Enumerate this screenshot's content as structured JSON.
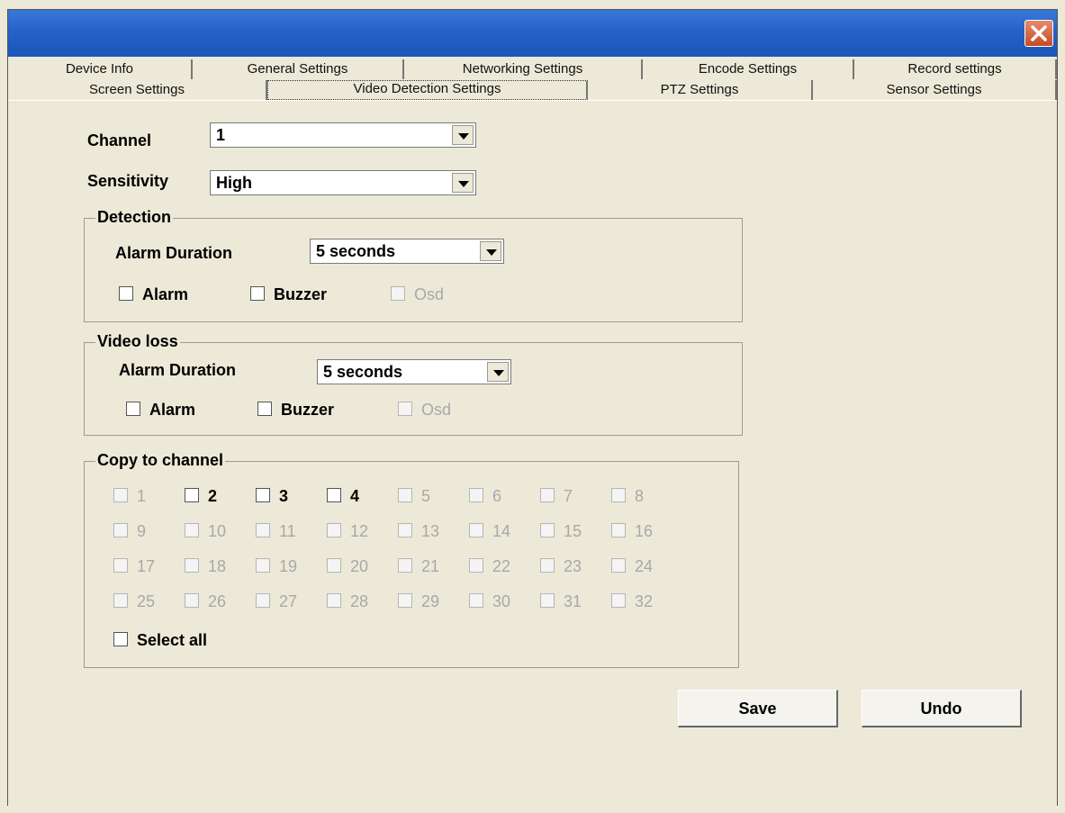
{
  "window": {
    "tabs_row1": [
      "Device Info",
      "General Settings",
      "Networking Settings",
      "Encode Settings",
      "Record settings"
    ],
    "tabs_row2": [
      "Screen Settings",
      "Video Detection Settings",
      "PTZ Settings",
      "Sensor Settings"
    ],
    "active_tab": "Video Detection Settings"
  },
  "form": {
    "channel_label": "Channel",
    "channel_value": "1",
    "sensitivity_label": "Sensitivity",
    "sensitivity_value": "High"
  },
  "detection": {
    "title": "Detection",
    "alarm_duration_label": "Alarm Duration",
    "alarm_duration_value": "5 seconds",
    "alarm": "Alarm",
    "buzzer": "Buzzer",
    "osd": "Osd"
  },
  "video_loss": {
    "title": "Video loss",
    "alarm_duration_label": "Alarm Duration",
    "alarm_duration_value": "5 seconds",
    "alarm": "Alarm",
    "buzzer": "Buzzer",
    "osd": "Osd"
  },
  "copy": {
    "title": "Copy to channel",
    "channels": [
      "1",
      "2",
      "3",
      "4",
      "5",
      "6",
      "7",
      "8",
      "9",
      "10",
      "11",
      "12",
      "13",
      "14",
      "15",
      "16",
      "17",
      "18",
      "19",
      "20",
      "21",
      "22",
      "23",
      "24",
      "25",
      "26",
      "27",
      "28",
      "29",
      "30",
      "31",
      "32"
    ],
    "enabled_channels": [
      "2",
      "3",
      "4"
    ],
    "select_all": "Select all"
  },
  "buttons": {
    "save": "Save",
    "undo": "Undo"
  },
  "colors": {
    "titlebar": "#2462c8",
    "close": "#c64b24",
    "face": "#ece9d8"
  }
}
